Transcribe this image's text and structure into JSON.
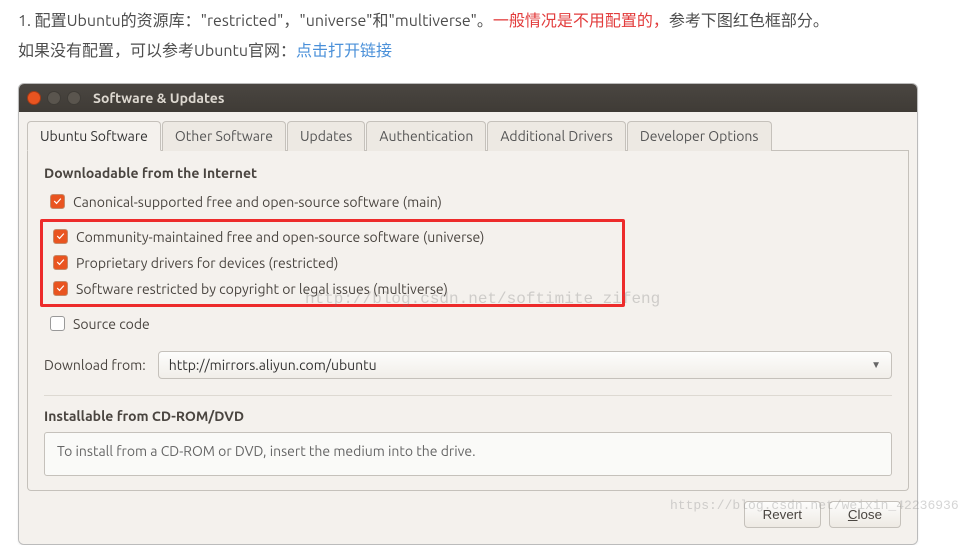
{
  "intro": {
    "line1_black": "1. 配置Ubuntu的资源库：\"restricted\"，\"universe\"和\"multiverse\"。",
    "line1_red": "一般情况是不用配置的，",
    "line1_black2": "参考下图红色框部分。",
    "line2_black": "如果没有配置，可以参考Ubuntu官网：",
    "link_text": "点击打开链接"
  },
  "titlebar": {
    "title": "Software & Updates"
  },
  "tabs": [
    "Ubuntu Software",
    "Other Software",
    "Updates",
    "Authentication",
    "Additional Drivers",
    "Developer Options"
  ],
  "section1": {
    "title": "Downloadable from the Internet",
    "items": [
      {
        "label": "Canonical-supported free and open-source software (main)",
        "checked": true
      },
      {
        "label": "Community-maintained free and open-source software (universe)",
        "checked": true
      },
      {
        "label": "Proprietary drivers for devices (restricted)",
        "checked": true
      },
      {
        "label": "Software restricted by copyright or legal issues (multiverse)",
        "checked": true
      },
      {
        "label": "Source code",
        "checked": false
      }
    ],
    "download_label": "Download from:",
    "download_value": "http://mirrors.aliyun.com/ubuntu"
  },
  "section2": {
    "title": "Installable from CD-ROM/DVD",
    "box_text": "To install from a CD-ROM or DVD, insert the medium into the drive."
  },
  "footer": {
    "revert": "Revert",
    "close_u": "C",
    "close_rest": "lose"
  },
  "watermark1": "http://blog.csdn.net/softimite_zifeng",
  "watermark2": "https://blog.csdn.net/weixin_42236936"
}
